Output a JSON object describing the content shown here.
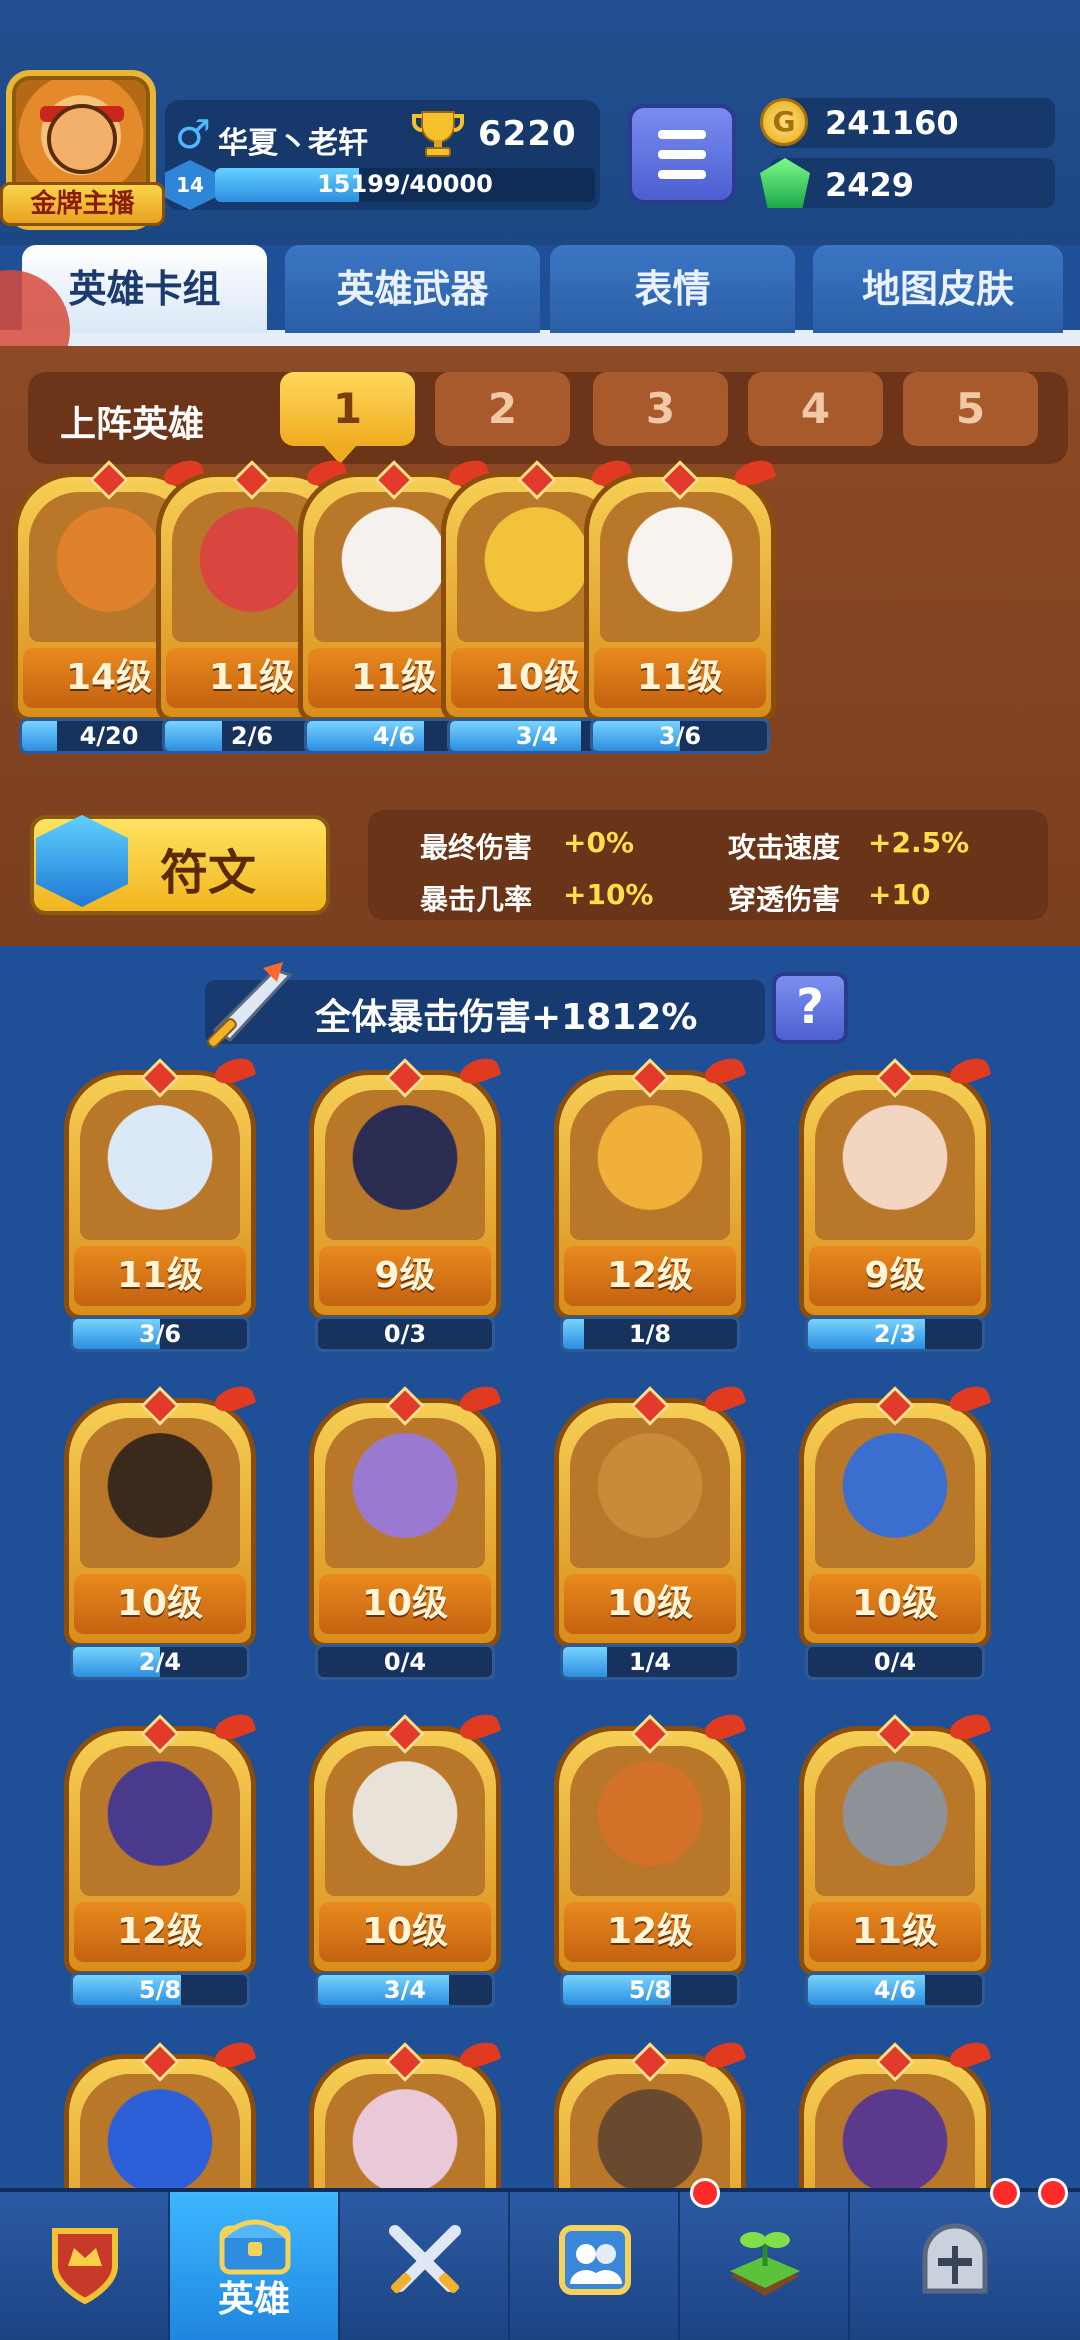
{
  "player": {
    "name": "华夏丶老轩",
    "title_badge": "金牌主播",
    "trophies": "6220",
    "level": "14",
    "xp_text": "15199/40000",
    "xp_fraction": 0.38
  },
  "currency": {
    "coins": "241160",
    "gems": "2429"
  },
  "tabs": [
    {
      "label": "英雄卡组",
      "active": true
    },
    {
      "label": "英雄武器",
      "active": false
    },
    {
      "label": "表情",
      "active": false
    },
    {
      "label": "地图皮肤",
      "active": false
    }
  ],
  "deck": {
    "label": "上阵英雄",
    "slots": [
      "1",
      "2",
      "3",
      "4",
      "5"
    ],
    "active_slot": "1",
    "heroes": [
      {
        "level": "14级",
        "progress": "4/20",
        "fraction": 0.2,
        "color": "#e0822c"
      },
      {
        "level": "11级",
        "progress": "2/6",
        "fraction": 0.33,
        "color": "#d9463f"
      },
      {
        "level": "11级",
        "progress": "4/6",
        "fraction": 0.67,
        "color": "#f4f1ee"
      },
      {
        "level": "10级",
        "progress": "3/4",
        "fraction": 0.75,
        "color": "#f2c23a"
      },
      {
        "level": "11级",
        "progress": "3/6",
        "fraction": 0.5,
        "color": "#f7f3ee"
      }
    ]
  },
  "runes": {
    "label": "符文",
    "stats": [
      {
        "label": "最终伤害",
        "value": "+0%"
      },
      {
        "label": "攻击速度",
        "value": "+2.5%"
      },
      {
        "label": "暴击几率",
        "value": "+10%"
      },
      {
        "label": "穿透伤害",
        "value": "+10"
      }
    ]
  },
  "collection": {
    "banner": "全体暴击伤害+1812%",
    "help": "?",
    "cards": [
      {
        "level": "11级",
        "progress": "3/6",
        "fraction": 0.5,
        "color": "#dbe9f6"
      },
      {
        "level": "9级",
        "progress": "0/3",
        "fraction": 0.0,
        "color": "#2b2d52"
      },
      {
        "level": "12级",
        "progress": "1/8",
        "fraction": 0.12,
        "color": "#f1b03a"
      },
      {
        "level": "9级",
        "progress": "2/3",
        "fraction": 0.67,
        "color": "#f3d6c2"
      },
      {
        "level": "10级",
        "progress": "2/4",
        "fraction": 0.5,
        "color": "#3b2a1c"
      },
      {
        "level": "10级",
        "progress": "0/4",
        "fraction": 0.0,
        "color": "#9a7ad0"
      },
      {
        "level": "10级",
        "progress": "1/4",
        "fraction": 0.25,
        "color": "#c98a3a"
      },
      {
        "level": "10级",
        "progress": "0/4",
        "fraction": 0.0,
        "color": "#3a6fd0"
      },
      {
        "level": "12级",
        "progress": "5/8",
        "fraction": 0.62,
        "color": "#4a3a8e"
      },
      {
        "level": "10级",
        "progress": "3/4",
        "fraction": 0.75,
        "color": "#e9e2d8"
      },
      {
        "level": "12级",
        "progress": "5/8",
        "fraction": 0.62,
        "color": "#d4722a"
      },
      {
        "level": "11级",
        "progress": "4/6",
        "fraction": 0.67,
        "color": "#8f9198"
      },
      {
        "level": "",
        "progress": "",
        "fraction": 0.0,
        "color": "#2d5fd8"
      },
      {
        "level": "",
        "progress": "",
        "fraction": 0.0,
        "color": "#e9c8d8"
      },
      {
        "level": "",
        "progress": "",
        "fraction": 0.0,
        "color": "#6a4a2e"
      },
      {
        "level": "",
        "progress": "",
        "fraction": 0.0,
        "color": "#5b3a8e"
      }
    ]
  },
  "bottom_nav": {
    "items": [
      {
        "icon": "crown-shield-icon"
      },
      {
        "icon": "treasure-chest-icon",
        "label": "英雄"
      },
      {
        "icon": "crossed-swords-icon"
      },
      {
        "icon": "friends-icon"
      },
      {
        "icon": "sprout-icon"
      },
      {
        "icon": "knight-helmet-icon"
      }
    ]
  }
}
